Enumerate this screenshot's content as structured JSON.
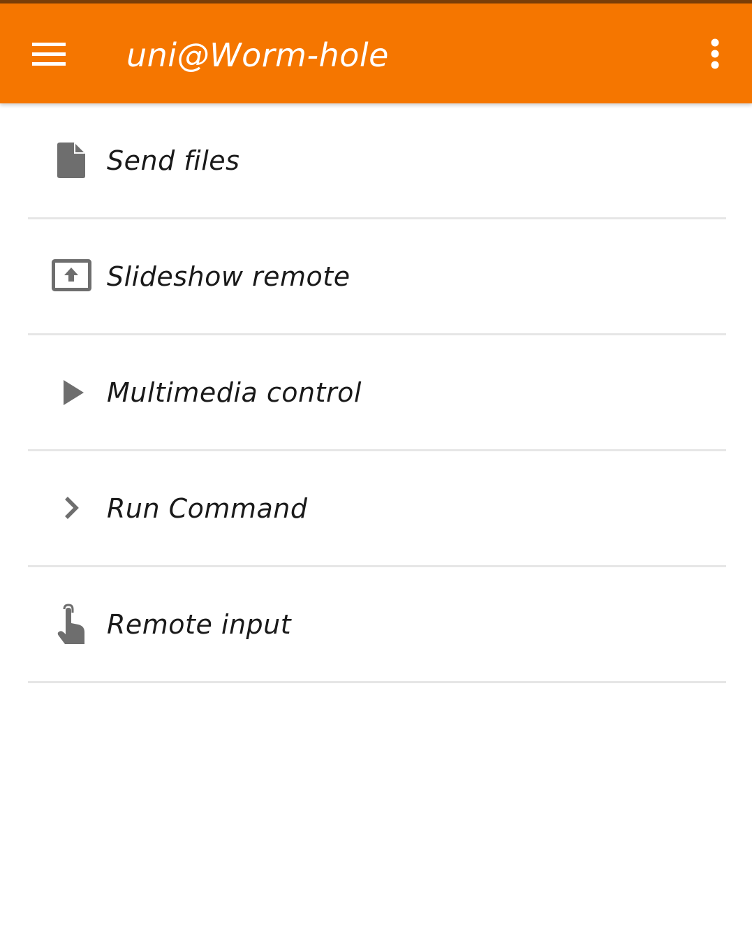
{
  "app_bar": {
    "title": "uni@Worm-hole",
    "menu_icon": "hamburger-menu-icon",
    "overflow_icon": "more-vertical-icon",
    "color": "#f57600"
  },
  "plugins": [
    {
      "label": "Send files",
      "icon": "file-icon"
    },
    {
      "label": "Slideshow remote",
      "icon": "presentation-upload-icon"
    },
    {
      "label": "Multimedia control",
      "icon": "play-icon"
    },
    {
      "label": "Run Command",
      "icon": "chevron-right-icon"
    },
    {
      "label": "Remote input",
      "icon": "touch-hand-icon"
    }
  ],
  "colors": {
    "accent": "#f57600",
    "icon": "#6e6e6e",
    "divider": "#e6e6e6",
    "text": "#1a1a1a"
  }
}
